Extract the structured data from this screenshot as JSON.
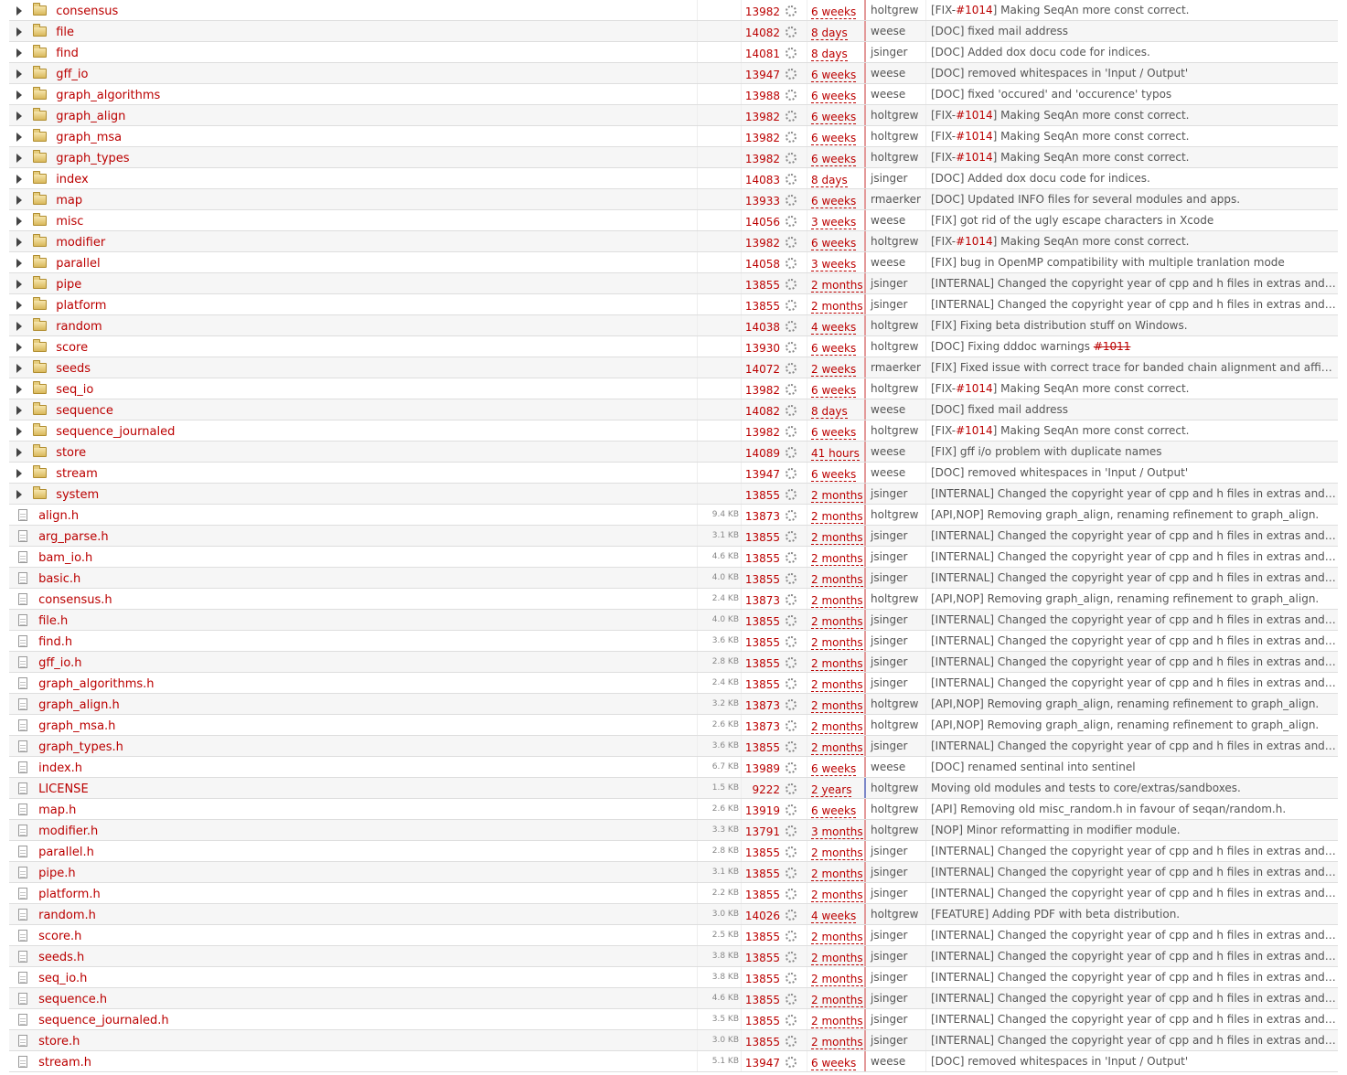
{
  "icons": {
    "expander": "triangle-right-icon",
    "folder": "folder-icon",
    "file": "file-icon",
    "changeset": "gear-icon"
  },
  "colors": {
    "link": "#bb0000",
    "separator": "#e39a9a",
    "separator_highlight": "#7d87c8",
    "row_alt": "#f6f6f6"
  },
  "rows": [
    {
      "type": "dir",
      "name": "consensus",
      "size": "",
      "rev": "13982",
      "age": "6 weeks",
      "author": "holtgrew",
      "change": [
        {
          "t": "[FIX-"
        },
        {
          "t": "#1014",
          "k": "ticket"
        },
        {
          "t": "] Making SeqAn more const correct."
        }
      ]
    },
    {
      "type": "dir",
      "name": "file",
      "size": "",
      "rev": "14082",
      "age": "8 days",
      "author": "weese",
      "change": [
        {
          "t": "[DOC] fixed mail address"
        }
      ]
    },
    {
      "type": "dir",
      "name": "find",
      "size": "",
      "rev": "14081",
      "age": "8 days",
      "author": "jsinger",
      "change": [
        {
          "t": "[DOC] Added dox docu code for indices."
        }
      ]
    },
    {
      "type": "dir",
      "name": "gff_io",
      "size": "",
      "rev": "13947",
      "age": "6 weeks",
      "author": "weese",
      "change": [
        {
          "t": "[DOC] removed whitespaces in 'Input / Output'"
        }
      ]
    },
    {
      "type": "dir",
      "name": "graph_algorithms",
      "size": "",
      "rev": "13988",
      "age": "6 weeks",
      "author": "weese",
      "change": [
        {
          "t": "[DOC] fixed 'occured' and 'occurence' typos"
        }
      ]
    },
    {
      "type": "dir",
      "name": "graph_align",
      "size": "",
      "rev": "13982",
      "age": "6 weeks",
      "author": "holtgrew",
      "change": [
        {
          "t": "[FIX-"
        },
        {
          "t": "#1014",
          "k": "ticket"
        },
        {
          "t": "] Making SeqAn more const correct."
        }
      ]
    },
    {
      "type": "dir",
      "name": "graph_msa",
      "size": "",
      "rev": "13982",
      "age": "6 weeks",
      "author": "holtgrew",
      "change": [
        {
          "t": "[FIX-"
        },
        {
          "t": "#1014",
          "k": "ticket"
        },
        {
          "t": "] Making SeqAn more const correct."
        }
      ]
    },
    {
      "type": "dir",
      "name": "graph_types",
      "size": "",
      "rev": "13982",
      "age": "6 weeks",
      "author": "holtgrew",
      "change": [
        {
          "t": "[FIX-"
        },
        {
          "t": "#1014",
          "k": "ticket"
        },
        {
          "t": "] Making SeqAn more const correct."
        }
      ]
    },
    {
      "type": "dir",
      "name": "index",
      "size": "",
      "rev": "14083",
      "age": "8 days",
      "author": "jsinger",
      "change": [
        {
          "t": "[DOC] Added dox docu code for indices."
        }
      ]
    },
    {
      "type": "dir",
      "name": "map",
      "size": "",
      "rev": "13933",
      "age": "6 weeks",
      "author": "rmaerker",
      "change": [
        {
          "t": "[DOC] Updated INFO files for several modules and apps."
        }
      ]
    },
    {
      "type": "dir",
      "name": "misc",
      "size": "",
      "rev": "14056",
      "age": "3 weeks",
      "author": "weese",
      "change": [
        {
          "t": "[FIX] got rid of the ugly escape characters in Xcode"
        }
      ]
    },
    {
      "type": "dir",
      "name": "modifier",
      "size": "",
      "rev": "13982",
      "age": "6 weeks",
      "author": "holtgrew",
      "change": [
        {
          "t": "[FIX-"
        },
        {
          "t": "#1014",
          "k": "ticket"
        },
        {
          "t": "] Making SeqAn more const correct."
        }
      ]
    },
    {
      "type": "dir",
      "name": "parallel",
      "size": "",
      "rev": "14058",
      "age": "3 weeks",
      "author": "weese",
      "change": [
        {
          "t": "[FIX] bug in OpenMP compatibility with multiple tranlation mode"
        }
      ]
    },
    {
      "type": "dir",
      "name": "pipe",
      "size": "",
      "rev": "13855",
      "age": "2 months",
      "author": "jsinger",
      "change": [
        {
          "t": "[INTERNAL] Changed the copyright year of cpp and h files in extras and ..."
        }
      ]
    },
    {
      "type": "dir",
      "name": "platform",
      "size": "",
      "rev": "13855",
      "age": "2 months",
      "author": "jsinger",
      "change": [
        {
          "t": "[INTERNAL] Changed the copyright year of cpp and h files in extras and ..."
        }
      ]
    },
    {
      "type": "dir",
      "name": "random",
      "size": "",
      "rev": "14038",
      "age": "4 weeks",
      "author": "holtgrew",
      "change": [
        {
          "t": "[FIX] Fixing beta distribution stuff on Windows."
        }
      ]
    },
    {
      "type": "dir",
      "name": "score",
      "size": "",
      "rev": "13930",
      "age": "6 weeks",
      "author": "holtgrew",
      "change": [
        {
          "t": "[DOC] Fixing dddoc warnings "
        },
        {
          "t": "#1011",
          "k": "closed"
        }
      ]
    },
    {
      "type": "dir",
      "name": "seeds",
      "size": "",
      "rev": "14072",
      "age": "2 weeks",
      "author": "rmaerker",
      "change": [
        {
          "t": "[FIX] Fixed issue with correct trace for banded chain alignment and affine ..."
        }
      ]
    },
    {
      "type": "dir",
      "name": "seq_io",
      "size": "",
      "rev": "13982",
      "age": "6 weeks",
      "author": "holtgrew",
      "change": [
        {
          "t": "[FIX-"
        },
        {
          "t": "#1014",
          "k": "ticket"
        },
        {
          "t": "] Making SeqAn more const correct."
        }
      ]
    },
    {
      "type": "dir",
      "name": "sequence",
      "size": "",
      "rev": "14082",
      "age": "8 days",
      "author": "weese",
      "change": [
        {
          "t": "[DOC] fixed mail address"
        }
      ]
    },
    {
      "type": "dir",
      "name": "sequence_journaled",
      "size": "",
      "rev": "13982",
      "age": "6 weeks",
      "author": "holtgrew",
      "change": [
        {
          "t": "[FIX-"
        },
        {
          "t": "#1014",
          "k": "ticket"
        },
        {
          "t": "] Making SeqAn more const correct."
        }
      ]
    },
    {
      "type": "dir",
      "name": "store",
      "size": "",
      "rev": "14089",
      "age": "41 hours",
      "author": "weese",
      "change": [
        {
          "t": "[FIX] gff i/o problem with duplicate names"
        }
      ]
    },
    {
      "type": "dir",
      "name": "stream",
      "size": "",
      "rev": "13947",
      "age": "6 weeks",
      "author": "weese",
      "change": [
        {
          "t": "[DOC] removed whitespaces in 'Input / Output'"
        }
      ]
    },
    {
      "type": "dir",
      "name": "system",
      "size": "",
      "rev": "13855",
      "age": "2 months",
      "author": "jsinger",
      "change": [
        {
          "t": "[INTERNAL] Changed the copyright year of cpp and h files in extras and ..."
        }
      ]
    },
    {
      "type": "file",
      "name": "align.h",
      "size": "9.4 KB",
      "rev": "13873",
      "age": "2 months",
      "author": "holtgrew",
      "change": [
        {
          "t": "[API,NOP] Removing graph_align, renaming refinement to graph_align."
        }
      ]
    },
    {
      "type": "file",
      "name": "arg_parse.h",
      "size": "3.1 KB",
      "rev": "13855",
      "age": "2 months",
      "author": "jsinger",
      "change": [
        {
          "t": "[INTERNAL] Changed the copyright year of cpp and h files in extras and ..."
        }
      ]
    },
    {
      "type": "file",
      "name": "bam_io.h",
      "size": "4.6 KB",
      "rev": "13855",
      "age": "2 months",
      "author": "jsinger",
      "change": [
        {
          "t": "[INTERNAL] Changed the copyright year of cpp and h files in extras and ..."
        }
      ]
    },
    {
      "type": "file",
      "name": "basic.h",
      "size": "4.0 KB",
      "rev": "13855",
      "age": "2 months",
      "author": "jsinger",
      "change": [
        {
          "t": "[INTERNAL] Changed the copyright year of cpp and h files in extras and ..."
        }
      ]
    },
    {
      "type": "file",
      "name": "consensus.h",
      "size": "2.4 KB",
      "rev": "13873",
      "age": "2 months",
      "author": "holtgrew",
      "change": [
        {
          "t": "[API,NOP] Removing graph_align, renaming refinement to graph_align."
        }
      ]
    },
    {
      "type": "file",
      "name": "file.h",
      "size": "4.0 KB",
      "rev": "13855",
      "age": "2 months",
      "author": "jsinger",
      "change": [
        {
          "t": "[INTERNAL] Changed the copyright year of cpp and h files in extras and ..."
        }
      ]
    },
    {
      "type": "file",
      "name": "find.h",
      "size": "3.6 KB",
      "rev": "13855",
      "age": "2 months",
      "author": "jsinger",
      "change": [
        {
          "t": "[INTERNAL] Changed the copyright year of cpp and h files in extras and ..."
        }
      ]
    },
    {
      "type": "file",
      "name": "gff_io.h",
      "size": "2.8 KB",
      "rev": "13855",
      "age": "2 months",
      "author": "jsinger",
      "change": [
        {
          "t": "[INTERNAL] Changed the copyright year of cpp and h files in extras and ..."
        }
      ]
    },
    {
      "type": "file",
      "name": "graph_algorithms.h",
      "size": "2.4 KB",
      "rev": "13855",
      "age": "2 months",
      "author": "jsinger",
      "change": [
        {
          "t": "[INTERNAL] Changed the copyright year of cpp and h files in extras and ..."
        }
      ]
    },
    {
      "type": "file",
      "name": "graph_align.h",
      "size": "3.2 KB",
      "rev": "13873",
      "age": "2 months",
      "author": "holtgrew",
      "change": [
        {
          "t": "[API,NOP] Removing graph_align, renaming refinement to graph_align."
        }
      ]
    },
    {
      "type": "file",
      "name": "graph_msa.h",
      "size": "2.6 KB",
      "rev": "13873",
      "age": "2 months",
      "author": "holtgrew",
      "change": [
        {
          "t": "[API,NOP] Removing graph_align, renaming refinement to graph_align."
        }
      ]
    },
    {
      "type": "file",
      "name": "graph_types.h",
      "size": "3.6 KB",
      "rev": "13855",
      "age": "2 months",
      "author": "jsinger",
      "change": [
        {
          "t": "[INTERNAL] Changed the copyright year of cpp and h files in extras and ..."
        }
      ]
    },
    {
      "type": "file",
      "name": "index.h",
      "size": "6.7 KB",
      "rev": "13989",
      "age": "6 weeks",
      "author": "weese",
      "change": [
        {
          "t": "[DOC] renamed sentinal into sentinel"
        }
      ]
    },
    {
      "type": "file",
      "name": "LICENSE",
      "size": "1.5 KB",
      "rev": "9222",
      "age": "2 years",
      "author": "holtgrew",
      "highlight": true,
      "change": [
        {
          "t": "Moving old modules and tests to core/extras/sandboxes."
        }
      ]
    },
    {
      "type": "file",
      "name": "map.h",
      "size": "2.6 KB",
      "rev": "13919",
      "age": "6 weeks",
      "author": "holtgrew",
      "change": [
        {
          "t": "[API] Removing old misc_random.h in favour of seqan/random.h."
        }
      ]
    },
    {
      "type": "file",
      "name": "modifier.h",
      "size": "3.3 KB",
      "rev": "13791",
      "age": "3 months",
      "author": "holtgrew",
      "change": [
        {
          "t": "[NOP] Minor reformatting in modifier module."
        }
      ]
    },
    {
      "type": "file",
      "name": "parallel.h",
      "size": "2.8 KB",
      "rev": "13855",
      "age": "2 months",
      "author": "jsinger",
      "change": [
        {
          "t": "[INTERNAL] Changed the copyright year of cpp and h files in extras and ..."
        }
      ]
    },
    {
      "type": "file",
      "name": "pipe.h",
      "size": "3.1 KB",
      "rev": "13855",
      "age": "2 months",
      "author": "jsinger",
      "change": [
        {
          "t": "[INTERNAL] Changed the copyright year of cpp and h files in extras and ..."
        }
      ]
    },
    {
      "type": "file",
      "name": "platform.h",
      "size": "2.2 KB",
      "rev": "13855",
      "age": "2 months",
      "author": "jsinger",
      "change": [
        {
          "t": "[INTERNAL] Changed the copyright year of cpp and h files in extras and ..."
        }
      ]
    },
    {
      "type": "file",
      "name": "random.h",
      "size": "3.0 KB",
      "rev": "14026",
      "age": "4 weeks",
      "author": "holtgrew",
      "change": [
        {
          "t": "[FEATURE] Adding PDF with beta distribution."
        }
      ]
    },
    {
      "type": "file",
      "name": "score.h",
      "size": "2.5 KB",
      "rev": "13855",
      "age": "2 months",
      "author": "jsinger",
      "change": [
        {
          "t": "[INTERNAL] Changed the copyright year of cpp and h files in extras and ..."
        }
      ]
    },
    {
      "type": "file",
      "name": "seeds.h",
      "size": "3.8 KB",
      "rev": "13855",
      "age": "2 months",
      "author": "jsinger",
      "change": [
        {
          "t": "[INTERNAL] Changed the copyright year of cpp and h files in extras and ..."
        }
      ]
    },
    {
      "type": "file",
      "name": "seq_io.h",
      "size": "3.8 KB",
      "rev": "13855",
      "age": "2 months",
      "author": "jsinger",
      "change": [
        {
          "t": "[INTERNAL] Changed the copyright year of cpp and h files in extras and ..."
        }
      ]
    },
    {
      "type": "file",
      "name": "sequence.h",
      "size": "4.6 KB",
      "rev": "13855",
      "age": "2 months",
      "author": "jsinger",
      "change": [
        {
          "t": "[INTERNAL] Changed the copyright year of cpp and h files in extras and ..."
        }
      ]
    },
    {
      "type": "file",
      "name": "sequence_journaled.h",
      "size": "3.5 KB",
      "rev": "13855",
      "age": "2 months",
      "author": "jsinger",
      "change": [
        {
          "t": "[INTERNAL] Changed the copyright year of cpp and h files in extras and ..."
        }
      ]
    },
    {
      "type": "file",
      "name": "store.h",
      "size": "3.0 KB",
      "rev": "13855",
      "age": "2 months",
      "author": "jsinger",
      "change": [
        {
          "t": "[INTERNAL] Changed the copyright year of cpp and h files in extras and ..."
        }
      ]
    },
    {
      "type": "file",
      "name": "stream.h",
      "size": "5.1 KB",
      "rev": "13947",
      "age": "6 weeks",
      "author": "weese",
      "change": [
        {
          "t": "[DOC] removed whitespaces in 'Input / Output'"
        }
      ]
    }
  ]
}
